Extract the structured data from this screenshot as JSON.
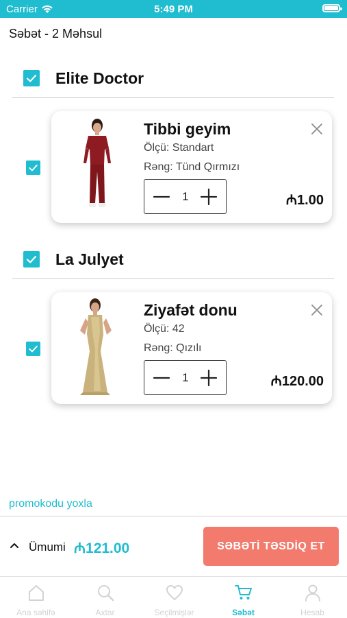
{
  "status_bar": {
    "carrier": "Carrier",
    "time": "5:49 PM"
  },
  "header": {
    "title": "Səbət - 2 Məhsul"
  },
  "stores": [
    {
      "name": "Elite Doctor",
      "item": {
        "name": "Tibbi geyim",
        "size": "Ölçü: Standart",
        "color": "Rəng: Tünd Qırmızı",
        "quantity": "1",
        "price": "₼1.00"
      }
    },
    {
      "name": "La Julyet",
      "item": {
        "name": "Ziyafət donu",
        "size": "Ölçü: 42",
        "color": "Rəng: Qızılı",
        "quantity": "1",
        "price": "₼120.00"
      }
    }
  ],
  "promo_link": "promokodu yoxla",
  "summary": {
    "total_label": "Ümumi",
    "total_value": "₼121.00",
    "confirm_label": "SƏBƏTİ TƏSDİQ ET"
  },
  "tabs": [
    {
      "label": "Ana səhifə",
      "icon": "home-icon"
    },
    {
      "label": "Axtar",
      "icon": "search-icon"
    },
    {
      "label": "Seçilmişlər",
      "icon": "heart-icon"
    },
    {
      "label": "Səbət",
      "icon": "cart-icon",
      "active": true
    },
    {
      "label": "Hesab",
      "icon": "user-icon"
    }
  ],
  "colors": {
    "accent": "#20bccf",
    "confirm": "#f27b6e",
    "inactive_tab": "#d3d3d3"
  }
}
